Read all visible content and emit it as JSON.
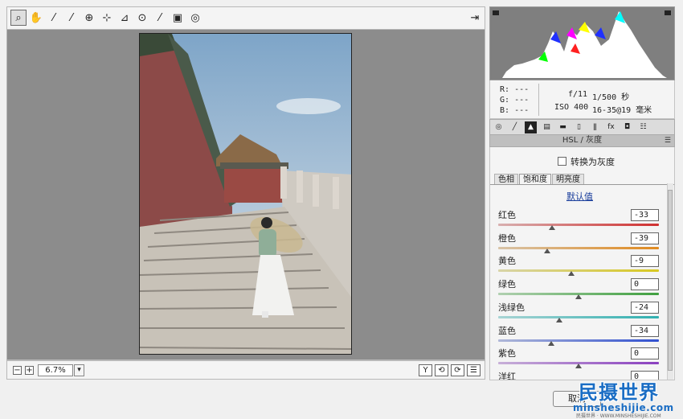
{
  "toolbar": {
    "tools": [
      "zoom-icon",
      "hand-icon",
      "white-balance-icon",
      "color-sampler-icon",
      "target-adjust-icon",
      "crop-icon",
      "straighten-icon",
      "red-eye-icon",
      "brush-icon",
      "gradient-icon",
      "radial-icon"
    ],
    "tool_glyphs": [
      "⌕",
      "✋",
      "⁄",
      "⁄",
      "⊕",
      "⊹",
      "⊿",
      "⊙",
      "⁄",
      "▣",
      "◎"
    ],
    "fullscreen_glyph": "⇥"
  },
  "status": {
    "minus": "−",
    "plus": "+",
    "zoom": "6.7%",
    "dropdown": "▾",
    "buttons": [
      "Y",
      "⟲",
      "⟳",
      "☰"
    ]
  },
  "info": {
    "r_label": "R:",
    "g_label": "G:",
    "b_label": "B:",
    "r_value": "---",
    "g_value": "---",
    "b_value": "---",
    "aperture": "f/11",
    "shutter": "1/500 秒",
    "iso": "ISO 400",
    "lens": "16-35@19 毫米"
  },
  "panel": {
    "tab_glyphs": [
      "◎",
      "╱",
      "▲",
      "▤",
      "▬",
      "▯",
      "ǁ",
      "fx",
      "◘",
      "☷"
    ],
    "title": "HSL / 灰度",
    "grayscale_label": "转换为灰度",
    "subtabs": [
      "色相",
      "饱和度",
      "明亮度"
    ],
    "default_link": "默认值",
    "sliders": [
      {
        "label": "红色",
        "value": "-33",
        "level": -33
      },
      {
        "label": "橙色",
        "value": "-39",
        "level": -39
      },
      {
        "label": "黄色",
        "value": "-9",
        "level": -9
      },
      {
        "label": "绿色",
        "value": "0",
        "level": 0
      },
      {
        "label": "浅绿色",
        "value": "-24",
        "level": -24
      },
      {
        "label": "蓝色",
        "value": "-34",
        "level": -34
      },
      {
        "label": "紫色",
        "value": "0",
        "level": 0
      },
      {
        "label": "洋红",
        "value": "0",
        "level": 0
      }
    ]
  },
  "footer": {
    "cancel": "取消"
  },
  "watermark": {
    "title": "民摄世界",
    "url": "minsheshijie.com",
    "small": "民摄世界 · WWW.MINSHESHIJIE.COM"
  },
  "colors": {
    "canvas_bg": "#8c8c8c",
    "panel_bg": "#f4f4f4",
    "link": "#1a3e9c",
    "slider_red": "#d03030",
    "slider_orange": "#e08a20",
    "slider_yellow": "#d8c820",
    "slider_green": "#40a040",
    "slider_aqua": "#30b0b0",
    "slider_blue": "#3050d0",
    "slider_purple": "#8a40c0",
    "slider_magenta": "#c030a0"
  }
}
